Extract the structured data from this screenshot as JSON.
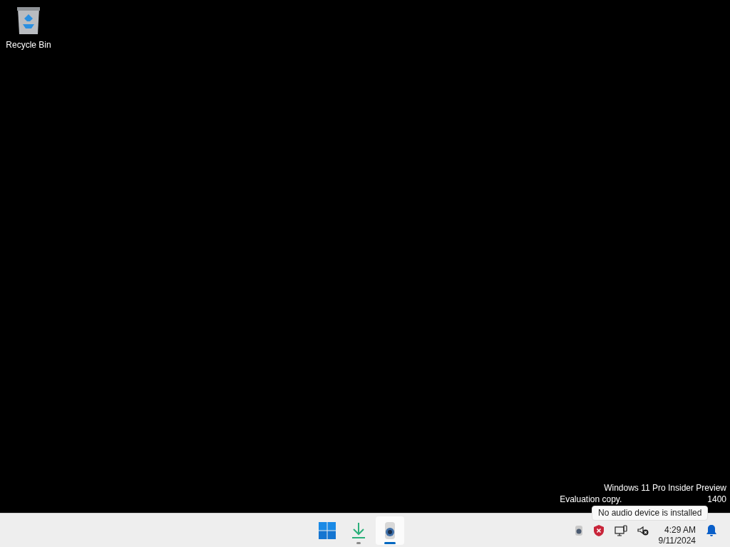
{
  "desktop_icons": [
    {
      "label": "Recycle Bin"
    }
  ],
  "watermark": {
    "line_1": "Windows 11 Pro Insider Preview",
    "line_2_start": "Evaluation copy.",
    "line_2_end": "1400"
  },
  "taskbar": {
    "apps": [
      {
        "kind": "start",
        "running": false,
        "active": false
      },
      {
        "kind": "download",
        "running": true,
        "active": false
      },
      {
        "kind": "camera",
        "running": true,
        "active": true
      }
    ],
    "tray": {
      "time": "4:29 AM",
      "date": "9/11/2024"
    }
  },
  "tooltip": {
    "text": "No audio device is installed"
  }
}
